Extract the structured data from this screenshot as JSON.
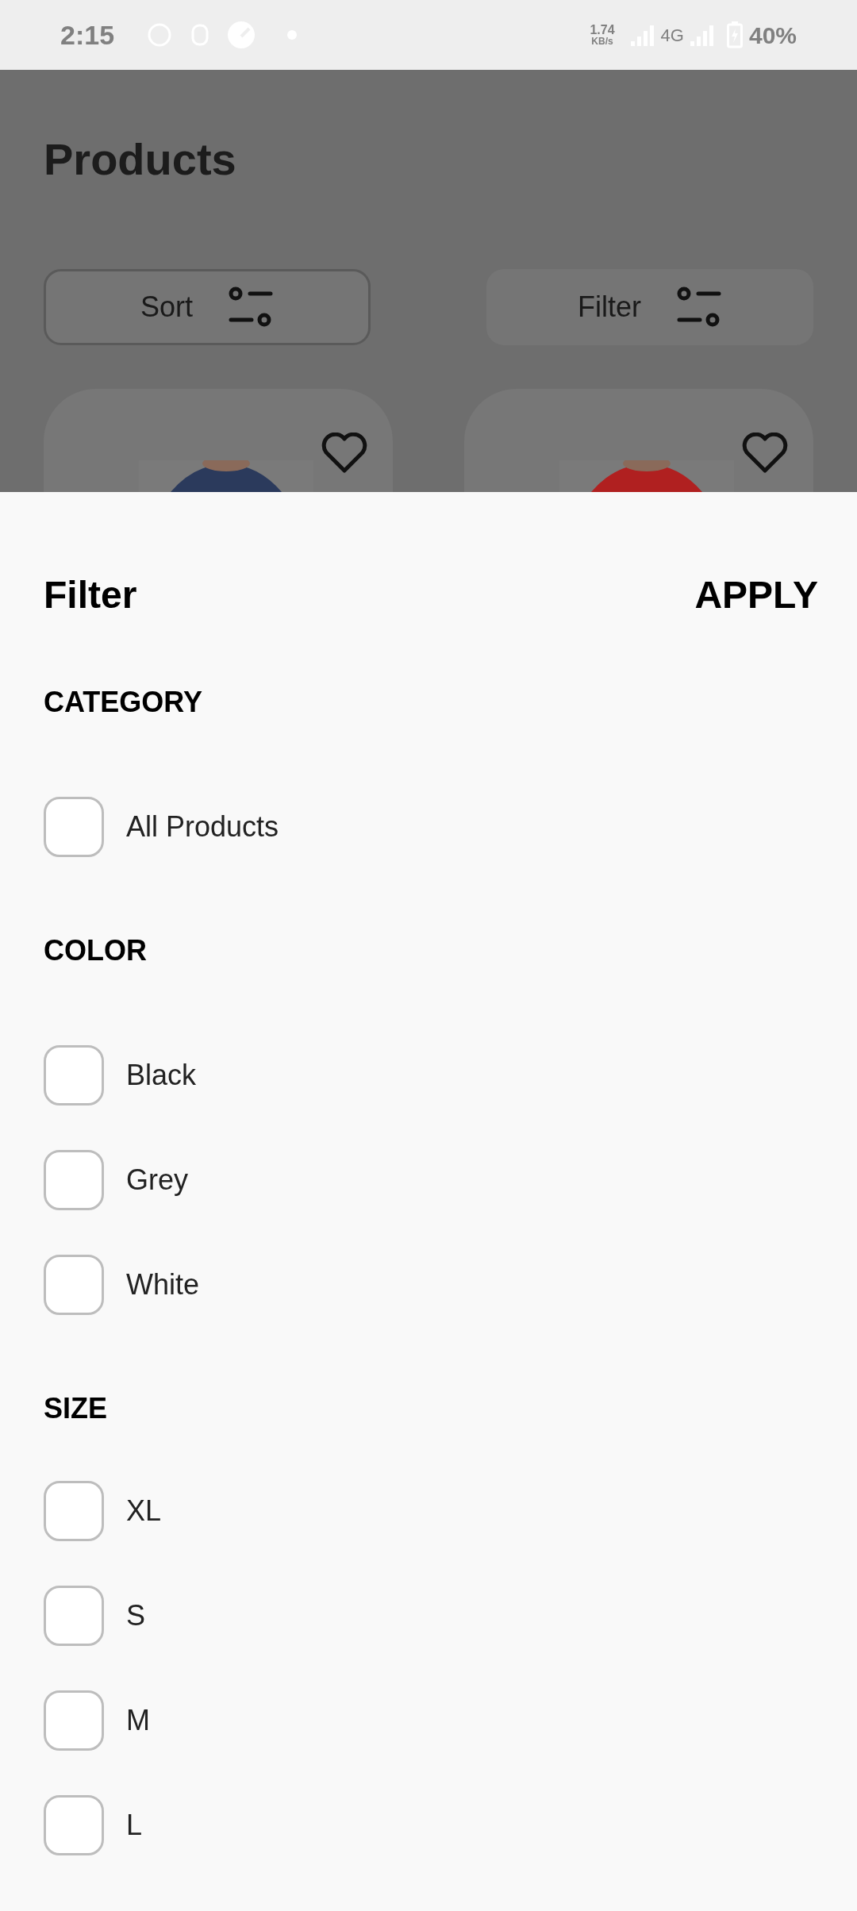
{
  "status_bar": {
    "time": "2:15",
    "speed": "1.74",
    "speed_unit": "KB/s",
    "network": "4G",
    "battery": "40%"
  },
  "page": {
    "title": "Products",
    "buttons": [
      {
        "label": "Sort",
        "outlined": true
      },
      {
        "label": "Filter",
        "outlined": false
      }
    ]
  },
  "filter_sheet": {
    "title": "Filter",
    "action": "APPLY",
    "sections": [
      {
        "heading": "CATEGORY",
        "options": [
          {
            "label": "All Products",
            "checked": false
          }
        ]
      },
      {
        "heading": "COLOR",
        "options": [
          {
            "label": "Black",
            "checked": false
          },
          {
            "label": "Grey",
            "checked": false
          },
          {
            "label": "White",
            "checked": false
          }
        ]
      },
      {
        "heading": "SIZE",
        "options": [
          {
            "label": "XL",
            "checked": false
          },
          {
            "label": "S",
            "checked": false
          },
          {
            "label": "M",
            "checked": false
          },
          {
            "label": "L",
            "checked": false
          }
        ]
      }
    ]
  }
}
